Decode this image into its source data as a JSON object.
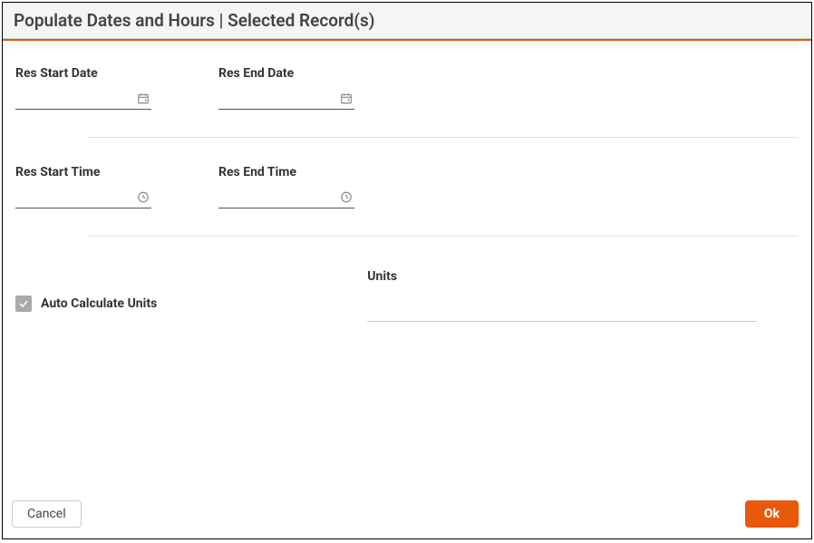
{
  "dialog": {
    "title": "Populate Dates and Hours | Selected Record(s)"
  },
  "fields": {
    "resStartDate": {
      "label": "Res Start Date",
      "value": ""
    },
    "resEndDate": {
      "label": "Res End Date",
      "value": ""
    },
    "resStartTime": {
      "label": "Res Start Time",
      "value": ""
    },
    "resEndTime": {
      "label": "Res End Time",
      "value": ""
    },
    "autoCalc": {
      "label": "Auto Calculate Units",
      "checked": true
    },
    "units": {
      "label": "Units",
      "value": ""
    }
  },
  "buttons": {
    "cancel": "Cancel",
    "ok": "Ok"
  }
}
